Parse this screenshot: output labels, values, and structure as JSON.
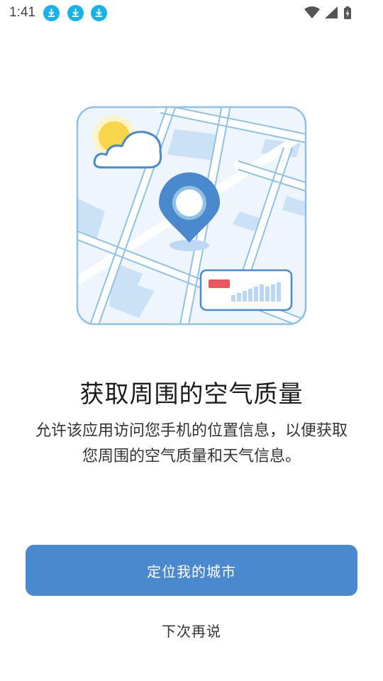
{
  "status_bar": {
    "time": "1:41",
    "notification_icons": [
      "download-icon",
      "download-icon",
      "download-icon"
    ],
    "system_icons": [
      "wifi-icon",
      "signal-icon",
      "battery-charging-icon"
    ]
  },
  "illustration": {
    "icons": [
      "sun-icon",
      "cloud-icon",
      "location-pin-icon",
      "air-quality-card-icon"
    ],
    "colors": {
      "map_bg": "#eef5fd",
      "road": "#8fc1e6",
      "pin": "#4a89cd",
      "sun": "#f8d54a",
      "alert": "#e8575b"
    }
  },
  "content": {
    "title": "获取周围的空气质量",
    "description": "允许该应用访问您手机的位置信息，以便获取您周围的空气质量和天气信息。"
  },
  "actions": {
    "primary_label": "定位我的城市",
    "secondary_label": "下次再说"
  },
  "colors": {
    "primary": "#4a89cd",
    "notification": "#16b3e8"
  }
}
